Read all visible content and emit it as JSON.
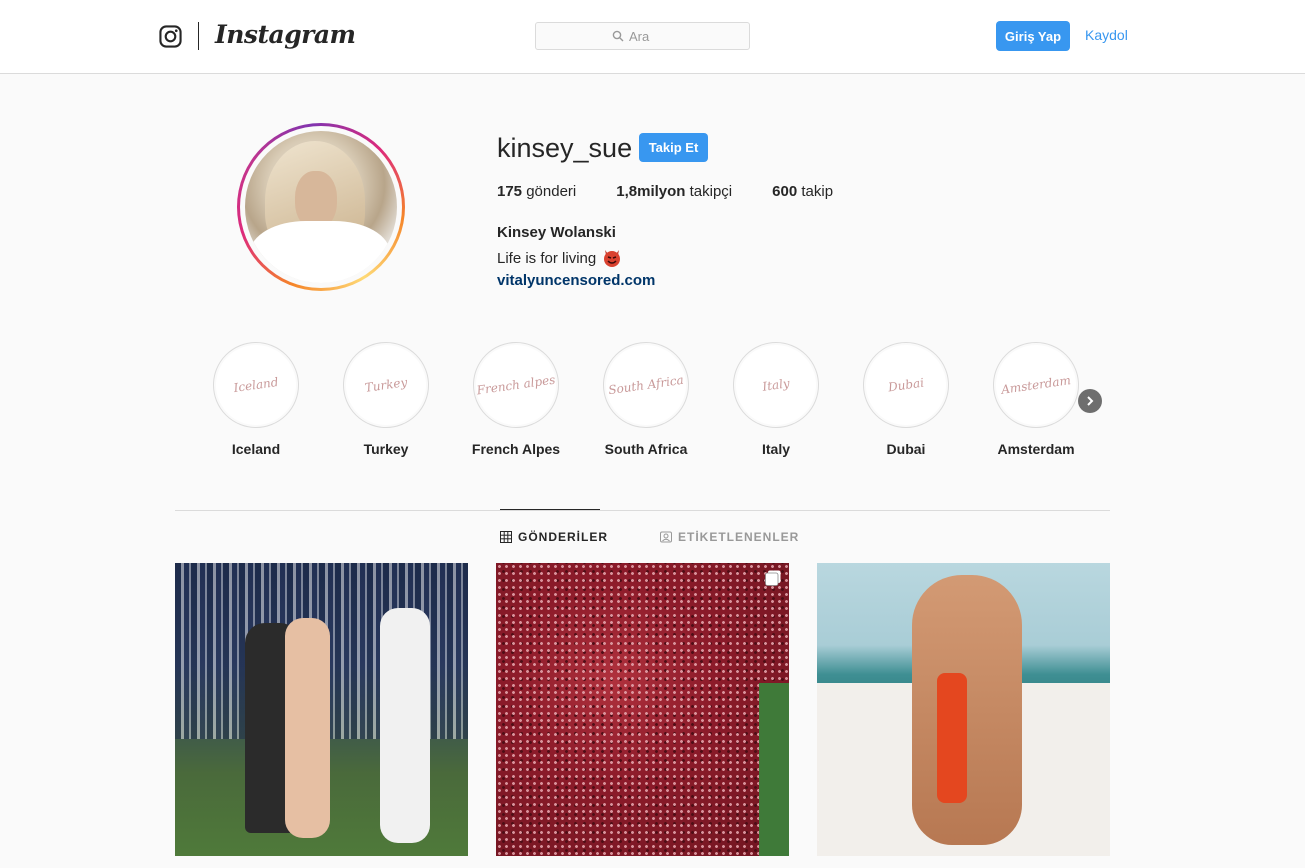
{
  "header": {
    "brand": "Instagram",
    "search_placeholder": "Ara",
    "login_label": "Giriş Yap",
    "signup_label": "Kaydol"
  },
  "profile": {
    "username": "kinsey_sue",
    "follow_label": "Takip Et",
    "stats": {
      "posts_count": "175",
      "posts_label": "gönderi",
      "followers_count": "1,8milyon",
      "followers_label": "takipçi",
      "following_count": "600",
      "following_label": "takip"
    },
    "full_name": "Kinsey Wolanski",
    "bio": "Life is for living",
    "bio_emoji": "devil-face-icon",
    "website": "vitalyuncensored.com"
  },
  "highlights": [
    {
      "label": "Iceland",
      "cover_text": "Iceland"
    },
    {
      "label": "Turkey",
      "cover_text": "Turkey"
    },
    {
      "label": "French Alpes",
      "cover_text": "French alpes"
    },
    {
      "label": "South Africa",
      "cover_text": "South Africa"
    },
    {
      "label": "Italy",
      "cover_text": "Italy"
    },
    {
      "label": "Dubai",
      "cover_text": "Dubai"
    },
    {
      "label": "Amsterdam",
      "cover_text": "Amsterdam"
    }
  ],
  "tabs": {
    "posts_label": "GÖNDERİLER",
    "tagged_label": "ETİKETLENENLER"
  },
  "colors": {
    "accent": "#3897f0",
    "link": "#003569",
    "border": "#dbdbdb",
    "text": "#262626"
  }
}
